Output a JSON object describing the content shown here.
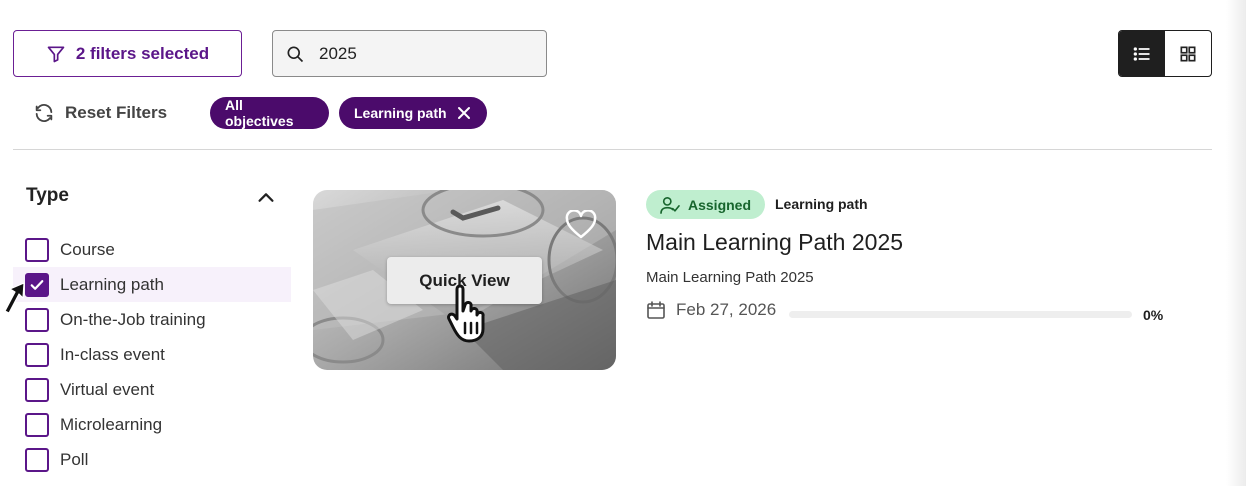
{
  "toolbar": {
    "filters_label": "2 filters selected",
    "search_value": "2025",
    "reset_label": "Reset Filters"
  },
  "active_filters": [
    {
      "label": "All objectives",
      "removable": false
    },
    {
      "label": "Learning path",
      "removable": true
    }
  ],
  "view_toggle": {
    "active": "list"
  },
  "sidebar": {
    "heading": "Type",
    "options": [
      {
        "label": "Course",
        "checked": false
      },
      {
        "label": "Learning path",
        "checked": true
      },
      {
        "label": "On-the-Job training",
        "checked": false
      },
      {
        "label": "In-class event",
        "checked": false
      },
      {
        "label": "Virtual event",
        "checked": false
      },
      {
        "label": "Microlearning",
        "checked": false
      },
      {
        "label": "Poll",
        "checked": false
      }
    ]
  },
  "card": {
    "quick_view_label": "Quick View",
    "status_badge": "Assigned",
    "type_label": "Learning path",
    "title": "Main Learning Path 2025",
    "description": "Main Learning Path 2025",
    "date": "Feb 27, 2026",
    "progress_percent": 0,
    "progress_label": "0%"
  },
  "colors": {
    "brand_purple": "#5b1689",
    "chip_bg": "#4b0b6b",
    "assigned_bg": "#bfeecf",
    "assigned_text": "#17652d"
  }
}
